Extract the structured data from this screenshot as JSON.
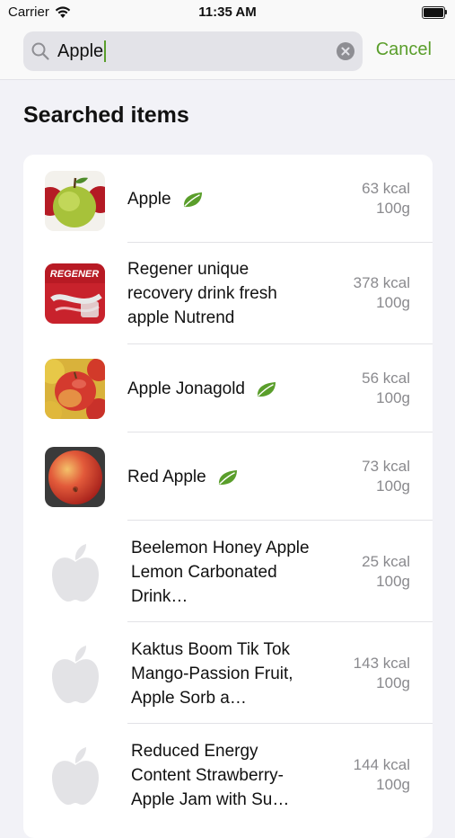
{
  "status_bar": {
    "carrier": "Carrier",
    "time": "11:35 AM",
    "battery_level": 1.0
  },
  "search": {
    "query": "Apple",
    "cancel_label": "Cancel",
    "accent_color": "#5a9e2b"
  },
  "section": {
    "title": "Searched items"
  },
  "items": [
    {
      "name": "Apple",
      "kcal": "63 kcal",
      "portion": "100g",
      "organic_badge": true,
      "image": "green-apple-photo"
    },
    {
      "name": "Regener unique recovery drink fresh apple Nutrend",
      "kcal": "378 kcal",
      "portion": "100g",
      "organic_badge": false,
      "image": "regener-package-photo",
      "image_text": "REGENER"
    },
    {
      "name": "Apple Jonagold",
      "kcal": "56 kcal",
      "portion": "100g",
      "organic_badge": true,
      "image": "jonagold-apples-photo"
    },
    {
      "name": "Red Apple",
      "kcal": "73 kcal",
      "portion": "100g",
      "organic_badge": true,
      "image": "red-apple-photo"
    },
    {
      "name": "Beelemon Honey Apple Lemon Carbonated Drink…",
      "kcal": "25 kcal",
      "portion": "100g",
      "organic_badge": false,
      "image": "apple-placeholder-icon"
    },
    {
      "name": "Kaktus Boom Tik Tok Mango-Passion Fruit, Apple Sorb a…",
      "kcal": "143 kcal",
      "portion": "100g",
      "organic_badge": false,
      "image": "apple-placeholder-icon"
    },
    {
      "name": "Reduced Energy Content Strawberry-Apple Jam with Su…",
      "kcal": "144 kcal",
      "portion": "100g",
      "organic_badge": false,
      "image": "apple-placeholder-icon"
    }
  ]
}
